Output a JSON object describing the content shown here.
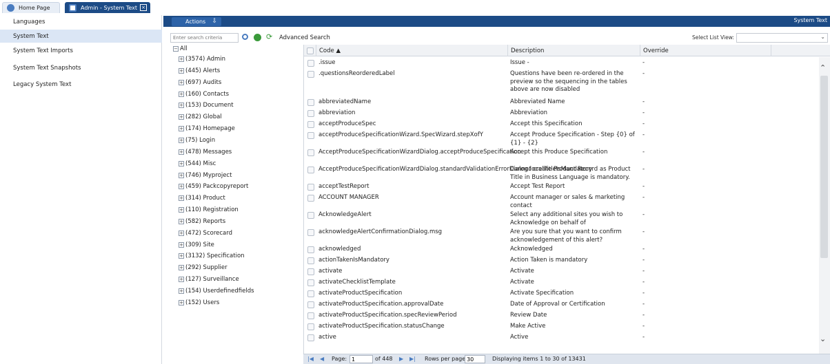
{
  "tabs": [
    {
      "label": "Home Page"
    },
    {
      "label": "Admin - System Text"
    }
  ],
  "sidebar": {
    "items": [
      {
        "label": "Languages"
      },
      {
        "label": "System Text"
      },
      {
        "label": "System Text Imports"
      },
      {
        "label": "System Text Snapshots"
      },
      {
        "label": "Legacy System Text"
      }
    ],
    "selected": "System Text"
  },
  "header": {
    "actions_label": "Actions",
    "title": "System Text"
  },
  "toolbar": {
    "search_placeholder": "Enter search criteria",
    "advanced_search": "Advanced Search",
    "list_view_label": "Select List View:",
    "list_view_value": ""
  },
  "tree": {
    "root": "All",
    "nodes": [
      "(3574) Admin",
      "(445) Alerts",
      "(697) Audits",
      "(160) Contacts",
      "(153) Document",
      "(282) Global",
      "(174) Homepage",
      "(75) Login",
      "(478) Messages",
      "(544) Misc",
      "(746) Myproject",
      "(459) Packcopyreport",
      "(314) Product",
      "(110) Registration",
      "(582) Reports",
      "(472) Scorecard",
      "(309) Site",
      "(3132) Specification",
      "(292) Supplier",
      "(127) Surveillance",
      "(154) Userdefinedfields",
      "(152) Users"
    ]
  },
  "grid": {
    "columns": {
      "code": "Code ▲",
      "description": "Description",
      "override": "Override"
    },
    "rows": [
      {
        "code": ".issue",
        "description": "Issue -",
        "override": "-"
      },
      {
        "code": ".questionsReorderedLabel",
        "description": "Questions have been re-ordered in the preview so the sequencing in the tables above are now disabled",
        "override": "-"
      },
      {
        "code": "abbreviatedName",
        "description": "Abbreviated Name",
        "override": "-"
      },
      {
        "code": "abbreviation",
        "description": "Abbreviation",
        "override": "-"
      },
      {
        "code": "acceptProduceSpec",
        "description": "Accept this Specification",
        "override": "-"
      },
      {
        "code": "acceptProduceSpecificationWizard.SpecWizard.stepXofY",
        "description": "Accept Produce Specification - Step {0} of {1} - {2}",
        "override": "-"
      },
      {
        "code": "AcceptProduceSpecificationWizardDialog.acceptProduceSpecification",
        "description": "Accept this Produce Specification",
        "override": "-"
      },
      {
        "code": "AcceptProduceSpecificationWizardDialog.standardValidationErrorDialog.localTitleIsMandatory",
        "description": "Cannot create Product Record as Product Title in Business Language is mandatory.",
        "override": "-"
      },
      {
        "code": "acceptTestReport",
        "description": "Accept Test Report",
        "override": "-"
      },
      {
        "code": "ACCOUNT MANAGER",
        "description": "Account manager or sales & marketing contact",
        "override": "-"
      },
      {
        "code": "AcknowledgeAlert",
        "description": "Select any additional sites you wish to Acknowledge on behalf of",
        "override": "-"
      },
      {
        "code": "acknowledgeAlertConfirmationDialog.msg",
        "description": "Are you sure that you want to confirm acknowledgement of this alert?",
        "override": "-"
      },
      {
        "code": "acknowledged",
        "description": "Acknowledged",
        "override": "-"
      },
      {
        "code": "actionTakenIsMandatory",
        "description": "Action Taken is mandatory",
        "override": "-"
      },
      {
        "code": "activate",
        "description": "Activate",
        "override": "-"
      },
      {
        "code": "activateChecklistTemplate",
        "description": "Activate",
        "override": "-"
      },
      {
        "code": "activateProductSpecification",
        "description": "Activate Specification",
        "override": "-"
      },
      {
        "code": "activateProductSpecification.approvalDate",
        "description": "Date of Approval or Certification",
        "override": "-"
      },
      {
        "code": "activateProductSpecification.specReviewPeriod",
        "description": "Review Date",
        "override": "-"
      },
      {
        "code": "activateProductSpecification.statusChange",
        "description": "Make Active",
        "override": "-"
      },
      {
        "code": "active",
        "description": "Active",
        "override": "-"
      }
    ]
  },
  "pager": {
    "page_label": "Page:",
    "page_value": "1",
    "of_label": "of 448",
    "rows_label": "Rows per page",
    "rows_value": "30",
    "display_text": "Displaying items 1 to 30 of 13431"
  }
}
